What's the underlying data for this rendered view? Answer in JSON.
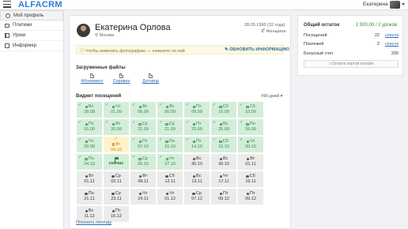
{
  "header": {
    "logo": "ALFACRM",
    "user_name": "Екатерина"
  },
  "sidebar": {
    "items": [
      {
        "label": "Мой профиль",
        "icon": "user-icon"
      },
      {
        "label": "Платежи",
        "icon": "card-icon"
      },
      {
        "label": "Уроки",
        "icon": "book-icon"
      },
      {
        "label": "Информер",
        "icon": "info-icon"
      }
    ]
  },
  "profile": {
    "name": "Екатерина Орлова",
    "city": "Москва",
    "birthday": "28.05.1990 (32 года)",
    "gender": "Женщина",
    "alert_text": "Чтобы изменить фотографию — кликните по ней",
    "update_label": "ОБНОВИТЬ ИНФОРМАЦИЮ"
  },
  "files": {
    "title": "Загруженные файлы",
    "items": [
      "Абонемент",
      "Справка",
      "Договор"
    ]
  },
  "widget": {
    "title": "Виджет посещений",
    "range": "±90 дней",
    "legend_link": "Показать легенду",
    "cells": [
      {
        "day": "Вс",
        "date": "28.08",
        "status": "green"
      },
      {
        "day": "Чт",
        "date": "01.09",
        "status": "green"
      },
      {
        "day": "Вт",
        "date": "06.09",
        "status": "green"
      },
      {
        "day": "Вт",
        "date": "06.09",
        "status": "green"
      },
      {
        "day": "Пт",
        "date": "09.09",
        "status": "green"
      },
      {
        "day": "Сб",
        "date": "10.09",
        "status": "green"
      },
      {
        "day": "Сб",
        "date": "10.09",
        "status": "green"
      },
      {
        "day": "Пт",
        "date": "16.09",
        "status": "green"
      },
      {
        "day": "Вт",
        "date": "20.09",
        "status": "green"
      },
      {
        "day": "Ср",
        "date": "21.09",
        "status": "green"
      },
      {
        "day": "Ср",
        "date": "21.09",
        "status": "green"
      },
      {
        "day": "Пт",
        "date": "23.09",
        "status": "green"
      },
      {
        "day": "Вс",
        "date": "25.09",
        "status": "green"
      },
      {
        "day": "Пн",
        "date": "26.09",
        "status": "green"
      },
      {
        "day": "Чт",
        "date": "29.09",
        "status": "green"
      },
      {
        "day": "Вт",
        "date": "04.10",
        "status": "yellow"
      },
      {
        "day": "Пт",
        "date": "07.10",
        "status": "green"
      },
      {
        "day": "Пн",
        "date": "10.10",
        "status": "green"
      },
      {
        "day": "Пт",
        "date": "14.10",
        "status": "green"
      },
      {
        "day": "Сб",
        "date": "15.10",
        "status": "green"
      },
      {
        "day": "Чт",
        "date": "20.10",
        "status": "green"
      },
      {
        "day": "Пн",
        "date": "24.10",
        "status": "green"
      },
      {
        "day": "",
        "date": "сейчас",
        "status": "now"
      },
      {
        "day": "Ср",
        "date": "26.10",
        "status": "green"
      },
      {
        "day": "Чт",
        "date": "27.10",
        "status": "green"
      },
      {
        "day": "Вс",
        "date": "30.10",
        "status": "gray"
      },
      {
        "day": "Вс",
        "date": "30.10",
        "status": "gray"
      },
      {
        "day": "Вт",
        "date": "01.11",
        "status": "gray"
      },
      {
        "day": "Вт",
        "date": "01.11",
        "status": "gray-x"
      },
      {
        "day": "Ср",
        "date": "02.11",
        "status": "gray"
      },
      {
        "day": "Вт",
        "date": "08.11",
        "status": "gray"
      },
      {
        "day": "Сб",
        "date": "12.11",
        "status": "gray"
      },
      {
        "day": "Вс",
        "date": "13.11",
        "status": "gray"
      },
      {
        "day": "Чт",
        "date": "17.11",
        "status": "gray"
      },
      {
        "day": "Сб",
        "date": "19.11",
        "status": "gray"
      },
      {
        "day": "Пн",
        "date": "21.11",
        "status": "gray-x"
      },
      {
        "day": "Ср",
        "date": "23.11",
        "status": "gray"
      },
      {
        "day": "Чт",
        "date": "24.11",
        "status": "gray"
      },
      {
        "day": "Чт",
        "date": "01.12",
        "status": "gray"
      },
      {
        "day": "Ср",
        "date": "07.12",
        "status": "gray"
      },
      {
        "day": "Пт",
        "date": "09.12",
        "status": "gray"
      },
      {
        "day": "Пт",
        "date": "09.12",
        "status": "gray"
      },
      {
        "day": "Вс",
        "date": "11.12",
        "status": "gray"
      },
      {
        "day": "Пт",
        "date": "16.12",
        "status": "gray"
      }
    ]
  },
  "balance": {
    "title": "Общий остаток",
    "value": "1 500,00 / 2 уроков",
    "visits_label": "Посещений",
    "visits_value": "22",
    "payments_label": "Платежей",
    "payments_value": "2",
    "list_link": "список",
    "bonus_label": "Бонусный счет",
    "bonus_value": "200",
    "pay_button": "Оплата картой онлайн"
  },
  "colors": {
    "brand": "#2e7fd4",
    "green": "#2e8b3e",
    "link": "#2a6bb0"
  }
}
